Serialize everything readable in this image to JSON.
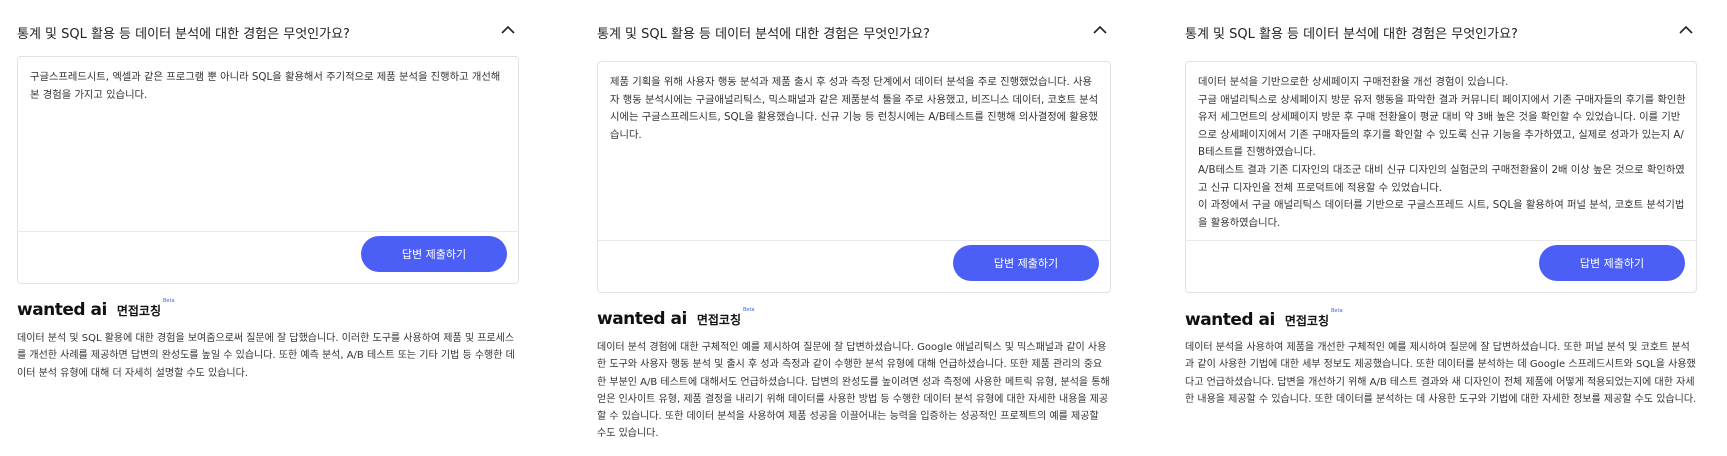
{
  "panels": [
    {
      "question": "통계 및 SQL 활용 등 데이터 분석에 대한 경험은 무엇인가요?",
      "answer": "구글스프레드시트, 엑셀과 같은 프로그램 뿐 아니라 SQL을 활용해서 주기적으로 제품 분석을 진행하고 개선해본 경험을 가지고 있습니다.",
      "submit_label": "답변 제출하기",
      "brand_logo": "wanted ai",
      "brand_title": "면접코칭",
      "brand_badge": "Beta",
      "feedback": "데이터 분석 및 SQL 활용에 대한 경험을 보여줌으로써 질문에 잘 답했습니다. 이러한 도구를 사용하여 제품 및 프로세스를 개선한 사례를 제공하면 답변의 완성도를 높일 수 있습니다. 또한 예측 분석, A/B 테스트 또는 기타 기법 등 수행한 데이터 분석 유형에 대해 더 자세히 설명할 수도 있습니다."
    },
    {
      "question": "통계 및 SQL 활용 등 데이터 분석에 대한 경험은 무엇인가요?",
      "answer": "제품 기획을 위해 사용자 행동 분석과 제품 출시 후 성과 측정 단계에서 데이터 분석을 주로 진행했었습니다. 사용자 행동 분석시에는 구글애널리틱스, 믹스패널과 같은 제품분석 툴을 주로 사용했고, 비즈니스 데이터, 코호트 분석시에는 구글스프레드시트, SQL을 활용했습니다. 신규 기능 등 런칭시에는 A/B테스트를 진행해 의사결정에 활용했습니다.",
      "submit_label": "답변 제출하기",
      "brand_logo": "wanted ai",
      "brand_title": "면접코칭",
      "brand_badge": "Beta",
      "feedback": "데이터 분석 경험에 대한 구체적인 예를 제시하여 질문에 잘 답변하셨습니다. Google 애널리틱스 및 믹스패널과 같이 사용한 도구와 사용자 행동 분석 및 출시 후 성과 측정과 같이 수행한 분석 유형에 대해 언급하셨습니다. 또한 제품 관리의 중요한 부분인 A/B 테스트에 대해서도 언급하셨습니다. 답변의 완성도를 높이려면 성과 측정에 사용한 메트릭 유형, 분석을 통해 얻은 인사이트 유형, 제품 결정을 내리기 위해 데이터를 사용한 방법 등 수행한 데이터 분석 유형에 대한 자세한 내용을 제공할 수 있습니다. 또한 데이터 분석을 사용하여 제품 성공을 이끌어내는 능력을 입증하는 성공적인 프로젝트의 예를 제공할 수도 있습니다."
    },
    {
      "question": "통계 및 SQL 활용 등 데이터 분석에 대한 경험은 무엇인가요?",
      "answer_lines": [
        "데이터 분석을 기반으로한 상세페이지 구매전환율 개선 경험이 있습니다.",
        "구글 애널리틱스로 상세페이지 방문 유저 행동을 파악한 결과 커뮤니티 페이지에서 기존 구매자들의 후기를 확인한 유저 세그먼트의 상세페이지 방문 후 구매 전환율이 평균 대비 약 3배 높은 것을 확인할 수 있었습니다. 이를 기반으로 상세페이지에서 기존 구매자들의 후기를 확인할 수 있도록 신규 기능을 추가하였고, 실제로 성과가 있는지 A/B테스트를 진행하였습니다.",
        "A/B테스트 결과 기존 디자인의 대조군 대비 신규 디자인의 실험군의 구매전환율이 2배 이상 높은 것으로 확인하였고 신규 디자인을 전체 프로덕트에 적용할 수 있었습니다.",
        "이 과정에서 구글 애널리틱스 데이터를 기반으로 구글스프레드 시트, SQL을 활용하여 퍼널 분석, 코호트 분석기법을 활용하였습니다."
      ],
      "submit_label": "답변 제출하기",
      "brand_logo": "wanted ai",
      "brand_title": "면접코칭",
      "brand_badge": "Beta",
      "feedback": "데이터 분석을 사용하여 제품을 개선한 구체적인 예를 제시하여 질문에 잘 답변하셨습니다. 또한 퍼널 분석 및 코호트 분석과 같이 사용한 기법에 대한 세부 정보도 제공했습니다. 또한 데이터를 분석하는 데 Google 스프레드시트와 SQL을 사용했다고 언급하셨습니다. 답변을 개선하기 위해 A/B 테스트 결과와 새 디자인이 전체 제품에 어떻게 적용되었는지에 대한 자세한 내용을 제공할 수 있습니다. 또한 데이터를 분석하는 데 사용한 도구와 기법에 대한 자세한 정보를 제공할 수도 있습니다."
    }
  ],
  "icons": {
    "collapse": "chevron-up-icon"
  },
  "colors": {
    "accent": "#4b5ef5",
    "border": "#e1e2e4",
    "beta": "#3366ff"
  }
}
